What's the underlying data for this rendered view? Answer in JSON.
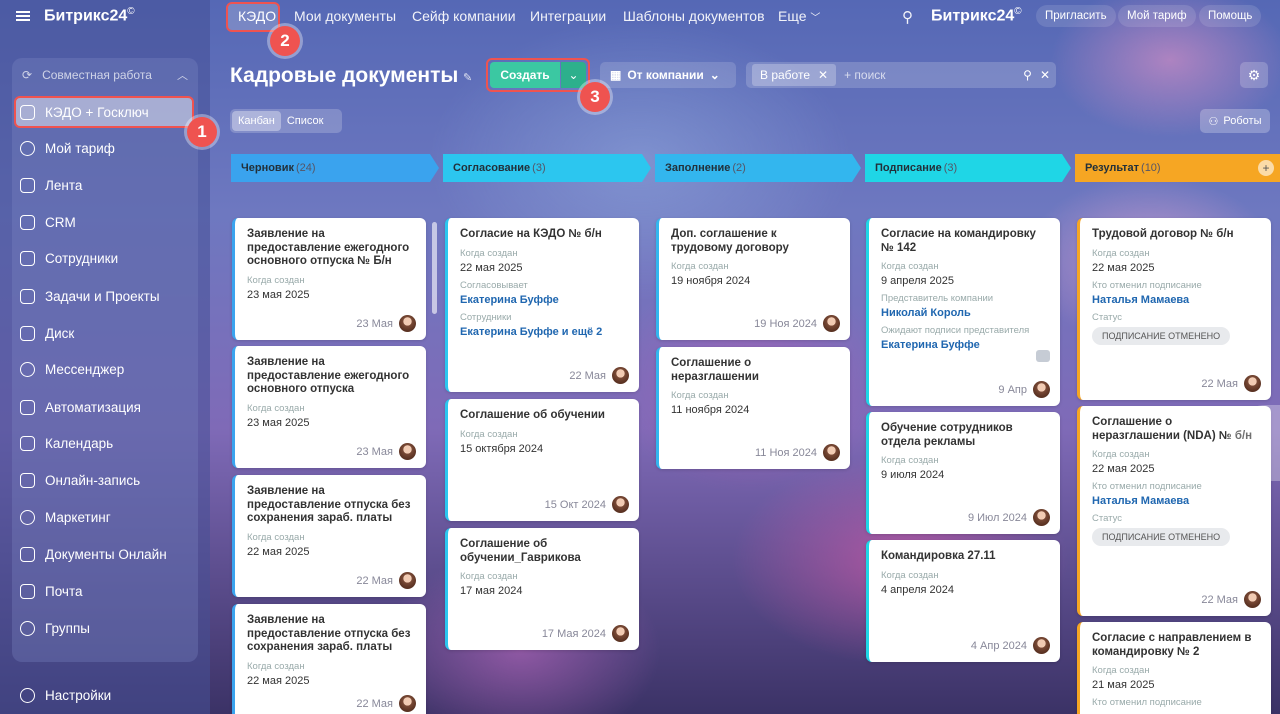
{
  "sidebar": {
    "brand": "Битрикс24",
    "brand_mark": "©",
    "group": "Совместная работа",
    "items": [
      {
        "label": "КЭДО + Госключ",
        "icon": "kedo-icon"
      },
      {
        "label": "Мой тариф",
        "icon": "tariff-icon"
      },
      {
        "label": "Лента",
        "icon": "feed-icon"
      },
      {
        "label": "CRM",
        "icon": "crm-icon"
      },
      {
        "label": "Сотрудники",
        "icon": "employees-icon"
      },
      {
        "label": "Задачи и Проекты",
        "icon": "tasks-icon"
      },
      {
        "label": "Диск",
        "icon": "disk-icon"
      },
      {
        "label": "Мессенджер",
        "icon": "messenger-icon"
      },
      {
        "label": "Автоматизация",
        "icon": "automation-icon"
      },
      {
        "label": "Календарь",
        "icon": "calendar-icon"
      },
      {
        "label": "Онлайн-запись",
        "icon": "booking-icon"
      },
      {
        "label": "Маркетинг",
        "icon": "marketing-icon"
      },
      {
        "label": "Документы Онлайн",
        "icon": "documents-icon"
      },
      {
        "label": "Почта",
        "icon": "mail-icon"
      },
      {
        "label": "Группы",
        "icon": "groups-icon"
      }
    ],
    "settings": "Настройки"
  },
  "topnav": {
    "items": [
      "КЭДО",
      "Мои документы",
      "Сейф компании",
      "Интеграции",
      "Шаблоны документов",
      "Еще"
    ],
    "brand": "Битрикс24",
    "invite": "Пригласить",
    "tariff": "Мой тариф",
    "help": "Помощь"
  },
  "header": {
    "title": "Кадровые документы",
    "create": "Создать",
    "from_company": "От компании",
    "filter_chip": "В работе",
    "search_placeholder": "+ поиск",
    "view_kanban": "Канбан",
    "view_list": "Список",
    "robots": "Роботы"
  },
  "badges": [
    "1",
    "2",
    "3"
  ],
  "columns": [
    {
      "name": "Черновик",
      "count": "(24)",
      "color": "#3aa3ee"
    },
    {
      "name": "Согласование",
      "count": "(3)",
      "color": "#2cc6ef"
    },
    {
      "name": "Заполнение",
      "count": "(2)",
      "color": "#33b6ee"
    },
    {
      "name": "Подписание",
      "count": "(3)",
      "color": "#1fd6e6"
    },
    {
      "name": "Результат",
      "count": "(10)",
      "color": "#f6a623"
    }
  ],
  "cards": {
    "c0": [
      {
        "title": "Заявление на предоставление ежегодного основного отпуска № Б/н",
        "label": "Когда создан",
        "date": "23 мая 2025",
        "foot": "23 Мая"
      },
      {
        "title": "Заявление на предоставление ежегодного основного отпуска",
        "label": "Когда создан",
        "date": "23 мая 2025",
        "foot": "23 Мая"
      },
      {
        "title": "Заявление на предоставление отпуска без сохранения зараб. платы",
        "label": "Когда создан",
        "date": "22 мая 2025",
        "foot": "22 Мая"
      },
      {
        "title": "Заявление на предоставление отпуска без сохранения зараб. платы",
        "label": "Когда создан",
        "date": "22 мая 2025",
        "foot": "22 Мая"
      }
    ],
    "c1": [
      {
        "title": "Согласие на КЭДО № б/н",
        "label": "Когда создан",
        "date": "22 мая 2025",
        "l2": "Согласовывает",
        "v2": "Екатерина Буффе",
        "l3": "Сотрудники",
        "v3": "Екатерина Буффе и ещё 2",
        "foot": "22 Мая"
      },
      {
        "title": "Соглашение об обучении",
        "label": "Когда создан",
        "date": "15 октября 2024",
        "foot": "15 Окт 2024"
      },
      {
        "title": "Соглашение об обучении_Гаврикова",
        "label": "Когда создан",
        "date": "17 мая 2024",
        "foot": "17 Мая 2024"
      }
    ],
    "c2": [
      {
        "title": "Доп. соглашение к трудовому договору",
        "label": "Когда создан",
        "date": "19 ноября 2024",
        "foot": "19 Ноя 2024"
      },
      {
        "title": "Соглашение о неразглашении",
        "label": "Когда создан",
        "date": "11 ноября 2024",
        "foot": "11 Ноя 2024"
      }
    ],
    "c3": [
      {
        "title": "Согласие на командировку № 142",
        "label": "Когда создан",
        "date": "9 апреля 2025",
        "l2": "Представитель компании",
        "v2": "Николай Король",
        "l3": "Ожидают подписи представителя",
        "v3": "Екатерина Буффе",
        "foot": "9 Апр"
      },
      {
        "title": "Обучение сотрудников отдела рекламы",
        "label": "Когда создан",
        "date": "9 июля 2024",
        "foot": "9 Июл 2024"
      },
      {
        "title": "Командировка 27.11",
        "label": "Когда создан",
        "date": "4 апреля 2024",
        "foot": "4 Апр 2024"
      }
    ],
    "c4": [
      {
        "title": "Трудовой договор № б/н",
        "label": "Когда создан",
        "date": "22 мая 2025",
        "l2": "Кто отменил подписание",
        "v2": "Наталья Мамаева",
        "l3": "Статус",
        "status": "ПОДПИСАНИЕ ОТМЕНЕНО",
        "foot": "22 Мая"
      },
      {
        "title": "Соглашение о неразглашении (NDA) № б/н",
        "label": "Когда создан",
        "date": "22 мая 2025",
        "l2": "Кто отменил подписание",
        "v2": "Наталья Мамаева",
        "l3": "Статус",
        "status": "ПОДПИСАНИЕ ОТМЕНЕНО",
        "foot": "22 Мая"
      },
      {
        "title": "Согласие с направлением в командировку № 2",
        "label": "Когда создан",
        "date": "21 мая 2025",
        "l2": "Кто отменил подписание"
      }
    ]
  }
}
